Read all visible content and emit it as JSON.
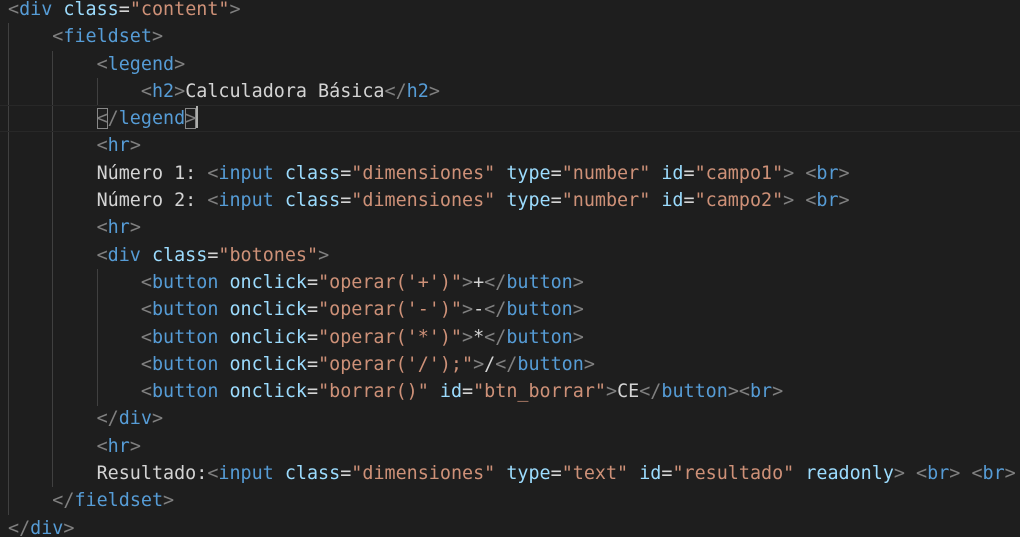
{
  "editor": {
    "language": "html",
    "lines": [
      [
        {
          "t": "<",
          "c": "tg"
        },
        {
          "t": "div",
          "c": "tn"
        },
        {
          "t": " ",
          "c": "tx"
        },
        {
          "t": "class",
          "c": "at"
        },
        {
          "t": "=",
          "c": "tx"
        },
        {
          "t": "\"content\"",
          "c": "sv"
        },
        {
          "t": ">",
          "c": "tg"
        }
      ],
      [
        {
          "t": "    ",
          "c": "tx"
        },
        {
          "t": "<",
          "c": "tg"
        },
        {
          "t": "fieldset",
          "c": "tn"
        },
        {
          "t": ">",
          "c": "tg"
        }
      ],
      [
        {
          "t": "        ",
          "c": "tx"
        },
        {
          "t": "<",
          "c": "tg"
        },
        {
          "t": "legend",
          "c": "tn"
        },
        {
          "t": ">",
          "c": "tg"
        }
      ],
      [
        {
          "t": "            ",
          "c": "tx"
        },
        {
          "t": "<",
          "c": "tg"
        },
        {
          "t": "h2",
          "c": "tn"
        },
        {
          "t": ">",
          "c": "tg"
        },
        {
          "t": "Calculadora Básica",
          "c": "tx"
        },
        {
          "t": "</",
          "c": "tg"
        },
        {
          "t": "h2",
          "c": "tn"
        },
        {
          "t": ">",
          "c": "tg"
        }
      ],
      [
        {
          "t": "        ",
          "c": "tx"
        },
        {
          "t": "<",
          "c": "tg",
          "m": 1
        },
        {
          "t": "/",
          "c": "tg"
        },
        {
          "t": "legend",
          "c": "tn"
        },
        {
          "t": ">",
          "c": "tg",
          "m": 1
        },
        {
          "cursor": 1
        }
      ],
      [
        {
          "t": "        ",
          "c": "tx"
        },
        {
          "t": "<",
          "c": "tg"
        },
        {
          "t": "hr",
          "c": "tn"
        },
        {
          "t": ">",
          "c": "tg"
        }
      ],
      [
        {
          "t": "        ",
          "c": "tx"
        },
        {
          "t": "Número 1: ",
          "c": "tx"
        },
        {
          "t": "<",
          "c": "tg"
        },
        {
          "t": "input",
          "c": "tn"
        },
        {
          "t": " ",
          "c": "tx"
        },
        {
          "t": "class",
          "c": "at"
        },
        {
          "t": "=",
          "c": "tx"
        },
        {
          "t": "\"dimensiones\"",
          "c": "sv"
        },
        {
          "t": " ",
          "c": "tx"
        },
        {
          "t": "type",
          "c": "at"
        },
        {
          "t": "=",
          "c": "tx"
        },
        {
          "t": "\"number\"",
          "c": "sv"
        },
        {
          "t": " ",
          "c": "tx"
        },
        {
          "t": "id",
          "c": "at"
        },
        {
          "t": "=",
          "c": "tx"
        },
        {
          "t": "\"campo1\"",
          "c": "sv"
        },
        {
          "t": ">",
          "c": "tg"
        },
        {
          "t": " ",
          "c": "tx"
        },
        {
          "t": "<",
          "c": "tg"
        },
        {
          "t": "br",
          "c": "tn"
        },
        {
          "t": ">",
          "c": "tg"
        }
      ],
      [
        {
          "t": "        ",
          "c": "tx"
        },
        {
          "t": "Número 2: ",
          "c": "tx"
        },
        {
          "t": "<",
          "c": "tg"
        },
        {
          "t": "input",
          "c": "tn"
        },
        {
          "t": " ",
          "c": "tx"
        },
        {
          "t": "class",
          "c": "at"
        },
        {
          "t": "=",
          "c": "tx"
        },
        {
          "t": "\"dimensiones\"",
          "c": "sv"
        },
        {
          "t": " ",
          "c": "tx"
        },
        {
          "t": "type",
          "c": "at"
        },
        {
          "t": "=",
          "c": "tx"
        },
        {
          "t": "\"number\"",
          "c": "sv"
        },
        {
          "t": " ",
          "c": "tx"
        },
        {
          "t": "id",
          "c": "at"
        },
        {
          "t": "=",
          "c": "tx"
        },
        {
          "t": "\"campo2\"",
          "c": "sv"
        },
        {
          "t": ">",
          "c": "tg"
        },
        {
          "t": " ",
          "c": "tx"
        },
        {
          "t": "<",
          "c": "tg"
        },
        {
          "t": "br",
          "c": "tn"
        },
        {
          "t": ">",
          "c": "tg"
        }
      ],
      [
        {
          "t": "        ",
          "c": "tx"
        },
        {
          "t": "<",
          "c": "tg"
        },
        {
          "t": "hr",
          "c": "tn"
        },
        {
          "t": ">",
          "c": "tg"
        }
      ],
      [
        {
          "t": "        ",
          "c": "tx"
        },
        {
          "t": "<",
          "c": "tg"
        },
        {
          "t": "div",
          "c": "tn"
        },
        {
          "t": " ",
          "c": "tx"
        },
        {
          "t": "class",
          "c": "at"
        },
        {
          "t": "=",
          "c": "tx"
        },
        {
          "t": "\"botones\"",
          "c": "sv"
        },
        {
          "t": ">",
          "c": "tg"
        }
      ],
      [
        {
          "t": "            ",
          "c": "tx"
        },
        {
          "t": "<",
          "c": "tg"
        },
        {
          "t": "button",
          "c": "tn"
        },
        {
          "t": " ",
          "c": "tx"
        },
        {
          "t": "onclick",
          "c": "at"
        },
        {
          "t": "=",
          "c": "tx"
        },
        {
          "t": "\"operar('+')\"",
          "c": "sv"
        },
        {
          "t": ">",
          "c": "tg"
        },
        {
          "t": "+",
          "c": "tx"
        },
        {
          "t": "</",
          "c": "tg"
        },
        {
          "t": "button",
          "c": "tn"
        },
        {
          "t": ">",
          "c": "tg"
        }
      ],
      [
        {
          "t": "            ",
          "c": "tx"
        },
        {
          "t": "<",
          "c": "tg"
        },
        {
          "t": "button",
          "c": "tn"
        },
        {
          "t": " ",
          "c": "tx"
        },
        {
          "t": "onclick",
          "c": "at"
        },
        {
          "t": "=",
          "c": "tx"
        },
        {
          "t": "\"operar('-')\"",
          "c": "sv"
        },
        {
          "t": ">",
          "c": "tg"
        },
        {
          "t": "-",
          "c": "tx"
        },
        {
          "t": "</",
          "c": "tg"
        },
        {
          "t": "button",
          "c": "tn"
        },
        {
          "t": ">",
          "c": "tg"
        }
      ],
      [
        {
          "t": "            ",
          "c": "tx"
        },
        {
          "t": "<",
          "c": "tg"
        },
        {
          "t": "button",
          "c": "tn"
        },
        {
          "t": " ",
          "c": "tx"
        },
        {
          "t": "onclick",
          "c": "at"
        },
        {
          "t": "=",
          "c": "tx"
        },
        {
          "t": "\"operar('*')\"",
          "c": "sv"
        },
        {
          "t": ">",
          "c": "tg"
        },
        {
          "t": "*",
          "c": "tx"
        },
        {
          "t": "</",
          "c": "tg"
        },
        {
          "t": "button",
          "c": "tn"
        },
        {
          "t": ">",
          "c": "tg"
        }
      ],
      [
        {
          "t": "            ",
          "c": "tx"
        },
        {
          "t": "<",
          "c": "tg"
        },
        {
          "t": "button",
          "c": "tn"
        },
        {
          "t": " ",
          "c": "tx"
        },
        {
          "t": "onclick",
          "c": "at"
        },
        {
          "t": "=",
          "c": "tx"
        },
        {
          "t": "\"operar('/');\"",
          "c": "sv"
        },
        {
          "t": ">",
          "c": "tg"
        },
        {
          "t": "/",
          "c": "tx"
        },
        {
          "t": "</",
          "c": "tg"
        },
        {
          "t": "button",
          "c": "tn"
        },
        {
          "t": ">",
          "c": "tg"
        }
      ],
      [
        {
          "t": "            ",
          "c": "tx"
        },
        {
          "t": "<",
          "c": "tg"
        },
        {
          "t": "button",
          "c": "tn"
        },
        {
          "t": " ",
          "c": "tx"
        },
        {
          "t": "onclick",
          "c": "at"
        },
        {
          "t": "=",
          "c": "tx"
        },
        {
          "t": "\"borrar()\"",
          "c": "sv"
        },
        {
          "t": " ",
          "c": "tx"
        },
        {
          "t": "id",
          "c": "at"
        },
        {
          "t": "=",
          "c": "tx"
        },
        {
          "t": "\"btn_borrar\"",
          "c": "sv"
        },
        {
          "t": ">",
          "c": "tg"
        },
        {
          "t": "CE",
          "c": "tx"
        },
        {
          "t": "</",
          "c": "tg"
        },
        {
          "t": "button",
          "c": "tn"
        },
        {
          "t": ">",
          "c": "tg"
        },
        {
          "t": "<",
          "c": "tg"
        },
        {
          "t": "br",
          "c": "tn"
        },
        {
          "t": ">",
          "c": "tg"
        }
      ],
      [
        {
          "t": "        ",
          "c": "tx"
        },
        {
          "t": "</",
          "c": "tg"
        },
        {
          "t": "div",
          "c": "tn"
        },
        {
          "t": ">",
          "c": "tg"
        }
      ],
      [
        {
          "t": "        ",
          "c": "tx"
        },
        {
          "t": "<",
          "c": "tg"
        },
        {
          "t": "hr",
          "c": "tn"
        },
        {
          "t": ">",
          "c": "tg"
        }
      ],
      [
        {
          "t": "        ",
          "c": "tx"
        },
        {
          "t": "Resultado:",
          "c": "tx"
        },
        {
          "t": "<",
          "c": "tg"
        },
        {
          "t": "input",
          "c": "tn"
        },
        {
          "t": " ",
          "c": "tx"
        },
        {
          "t": "class",
          "c": "at"
        },
        {
          "t": "=",
          "c": "tx"
        },
        {
          "t": "\"dimensiones\"",
          "c": "sv"
        },
        {
          "t": " ",
          "c": "tx"
        },
        {
          "t": "type",
          "c": "at"
        },
        {
          "t": "=",
          "c": "tx"
        },
        {
          "t": "\"text\"",
          "c": "sv"
        },
        {
          "t": " ",
          "c": "tx"
        },
        {
          "t": "id",
          "c": "at"
        },
        {
          "t": "=",
          "c": "tx"
        },
        {
          "t": "\"resultado\"",
          "c": "sv"
        },
        {
          "t": " ",
          "c": "tx"
        },
        {
          "t": "readonly",
          "c": "at"
        },
        {
          "t": ">",
          "c": "tg"
        },
        {
          "t": " ",
          "c": "tx"
        },
        {
          "t": "<",
          "c": "tg"
        },
        {
          "t": "br",
          "c": "tn"
        },
        {
          "t": ">",
          "c": "tg"
        },
        {
          "t": " ",
          "c": "tx"
        },
        {
          "t": "<",
          "c": "tg"
        },
        {
          "t": "br",
          "c": "tn"
        },
        {
          "t": ">",
          "c": "tg"
        }
      ],
      [
        {
          "t": "    ",
          "c": "tx"
        },
        {
          "t": "</",
          "c": "tg"
        },
        {
          "t": "fieldset",
          "c": "tn"
        },
        {
          "t": ">",
          "c": "tg"
        }
      ],
      [
        {
          "t": "</",
          "c": "tg"
        },
        {
          "t": "div",
          "c": "tn"
        },
        {
          "t": ">",
          "c": "tg"
        }
      ]
    ],
    "current_line": 5
  },
  "colors": {
    "background": "#1e1e1e",
    "punctuation": "#808080",
    "tag_name": "#569cd6",
    "attribute": "#9cdcfe",
    "string": "#ce9178",
    "text": "#d4d4d4"
  }
}
